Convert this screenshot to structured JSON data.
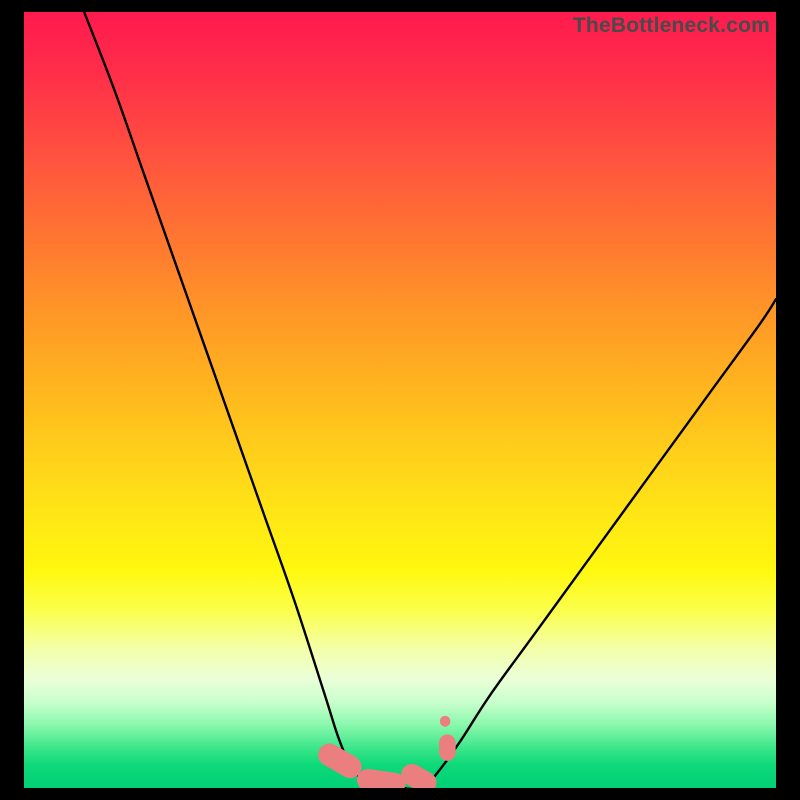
{
  "watermark": "TheBottleneck.com",
  "colors": {
    "frame": "#000000",
    "gradient_top": "#ff1a4e",
    "gradient_bottom": "#00d074",
    "curve": "#000000",
    "markers": "#eb7e7e"
  },
  "chart_data": {
    "type": "line",
    "title": "",
    "xlabel": "",
    "ylabel": "",
    "xlim": [
      0,
      100
    ],
    "ylim": [
      0,
      100
    ],
    "grid": false,
    "legend": false,
    "notes": "No axes shown. y appears to be bottleneck percentage (top = 100, bottom = 0). Background color encodes y: red near top (bad), green near bottom (good). Curve is V-shaped with flat minimum near zero.",
    "series": [
      {
        "name": "bottleneck-curve",
        "x": [
          8,
          12,
          16,
          20,
          24,
          28,
          32,
          36,
          40,
          42,
          44,
          47,
          50,
          53,
          55,
          58,
          62,
          68,
          74,
          80,
          86,
          92,
          98,
          100
        ],
        "y": [
          100,
          90,
          79,
          68,
          57,
          46,
          35,
          24,
          12,
          6,
          2,
          0,
          0,
          0,
          2,
          6,
          12,
          20,
          28,
          36,
          44,
          52,
          60,
          63
        ]
      }
    ],
    "markers": [
      {
        "shape": "pill",
        "cx": 42.0,
        "cy": 3.5,
        "w": 3.0,
        "h": 6.0,
        "angle": -60
      },
      {
        "shape": "pill",
        "cx": 47.5,
        "cy": 0.8,
        "w": 6.5,
        "h": 2.8,
        "angle": 8
      },
      {
        "shape": "pill",
        "cx": 52.5,
        "cy": 1.2,
        "w": 5.0,
        "h": 2.8,
        "angle": 30
      },
      {
        "shape": "blob",
        "cx": 56.3,
        "cy": 5.2,
        "w": 2.2,
        "h": 3.4,
        "angle": 0
      },
      {
        "shape": "dot",
        "cx": 56.0,
        "cy": 8.6,
        "w": 1.4,
        "h": 1.4,
        "angle": 0
      }
    ]
  }
}
